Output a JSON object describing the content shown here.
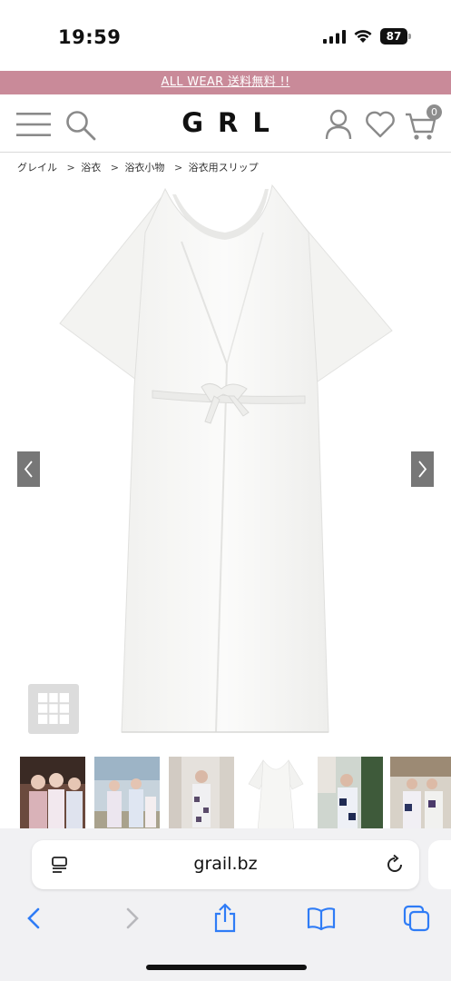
{
  "status": {
    "time": "19:59",
    "battery": "87"
  },
  "promo": {
    "text": "ALL WEAR 送料無料 !!"
  },
  "header": {
    "logo": "GRL",
    "cart_count": "0"
  },
  "breadcrumb": {
    "items": [
      "グレイル",
      "浴衣",
      "浴衣小物",
      "浴衣用スリップ"
    ],
    "separator": ">"
  },
  "gallery": {
    "thumbnail_count": 7
  },
  "browser": {
    "url": "grail.bz"
  },
  "colors": {
    "promo_bg": "#c98a99",
    "icon_gray": "#8a8a8a",
    "safari_blue": "#2f7cf6"
  }
}
